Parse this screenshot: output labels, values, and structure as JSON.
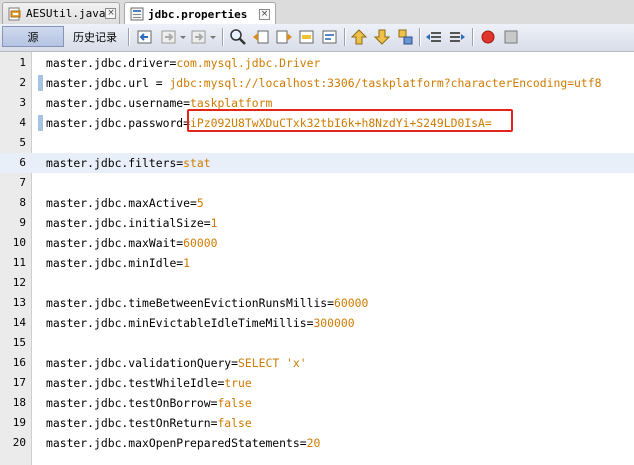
{
  "tabs": [
    {
      "label": "AESUtil.java",
      "close": "×",
      "icon": "java-file-icon",
      "active": false
    },
    {
      "label": "jdbc.properties",
      "close": "×",
      "icon": "properties-file-icon",
      "active": true
    }
  ],
  "toolbar": {
    "source_label": "源",
    "history_label": "历史记录",
    "icons": [
      "back-icon",
      "forward-history-icon",
      "dropdown-icon",
      "find-icon",
      "find-previous-icon",
      "find-next-icon",
      "toggle-highlight-icon",
      "find-selection-icon",
      "previous-bookmark-icon",
      "next-bookmark-icon",
      "toggle-bookmark-icon",
      "shift-left-icon",
      "shift-right-icon",
      "record-macro-icon",
      "stop-macro-icon"
    ]
  },
  "colors": {
    "value_text": "#ce7b00",
    "highlight_border": "#e3241b",
    "change_marker": "#a8c2e6"
  },
  "lines": [
    {
      "num": "1",
      "key": "master.jdbc.driver=",
      "value": "com.mysql.jdbc.Driver",
      "marked": false
    },
    {
      "num": "2",
      "key": "master.jdbc.url = ",
      "value": "jdbc:mysql://localhost:3306/taskplatform?characterEncoding=utf8",
      "marked": true
    },
    {
      "num": "3",
      "key": "master.jdbc.username=",
      "value": "taskplatform",
      "marked": false
    },
    {
      "num": "4",
      "key": "master.jdbc.password=",
      "value": "iPz092U8TwXDuCTxk32tbI6k+h8NzdYi+S249LD0IsA=",
      "marked": true
    },
    {
      "num": "5",
      "key": "",
      "value": "",
      "marked": false
    },
    {
      "num": "6",
      "key": "master.jdbc.filters=",
      "value": "stat",
      "marked": false
    },
    {
      "num": "7",
      "key": "",
      "value": "",
      "marked": false
    },
    {
      "num": "8",
      "key": "master.jdbc.maxActive=",
      "value": "5",
      "marked": false
    },
    {
      "num": "9",
      "key": "master.jdbc.initialSize=",
      "value": "1",
      "marked": false
    },
    {
      "num": "10",
      "key": "master.jdbc.maxWait=",
      "value": "60000",
      "marked": false
    },
    {
      "num": "11",
      "key": "master.jdbc.minIdle=",
      "value": "1",
      "marked": false
    },
    {
      "num": "12",
      "key": "",
      "value": "",
      "marked": false
    },
    {
      "num": "13",
      "key": "master.jdbc.timeBetweenEvictionRunsMillis=",
      "value": "60000",
      "marked": false
    },
    {
      "num": "14",
      "key": "master.jdbc.minEvictableIdleTimeMillis=",
      "value": "300000",
      "marked": false
    },
    {
      "num": "15",
      "key": "",
      "value": "",
      "marked": false
    },
    {
      "num": "16",
      "key": "master.jdbc.validationQuery=",
      "value": "SELECT 'x'",
      "marked": false
    },
    {
      "num": "17",
      "key": "master.jdbc.testWhileIdle=",
      "value": "true",
      "marked": false
    },
    {
      "num": "18",
      "key": "master.jdbc.testOnBorrow=",
      "value": "false",
      "marked": false
    },
    {
      "num": "19",
      "key": "master.jdbc.testOnReturn=",
      "value": "false",
      "marked": false
    },
    {
      "num": "20",
      "key": "master.jdbc.maxOpenPreparedStatements=",
      "value": "20",
      "marked": false
    }
  ]
}
